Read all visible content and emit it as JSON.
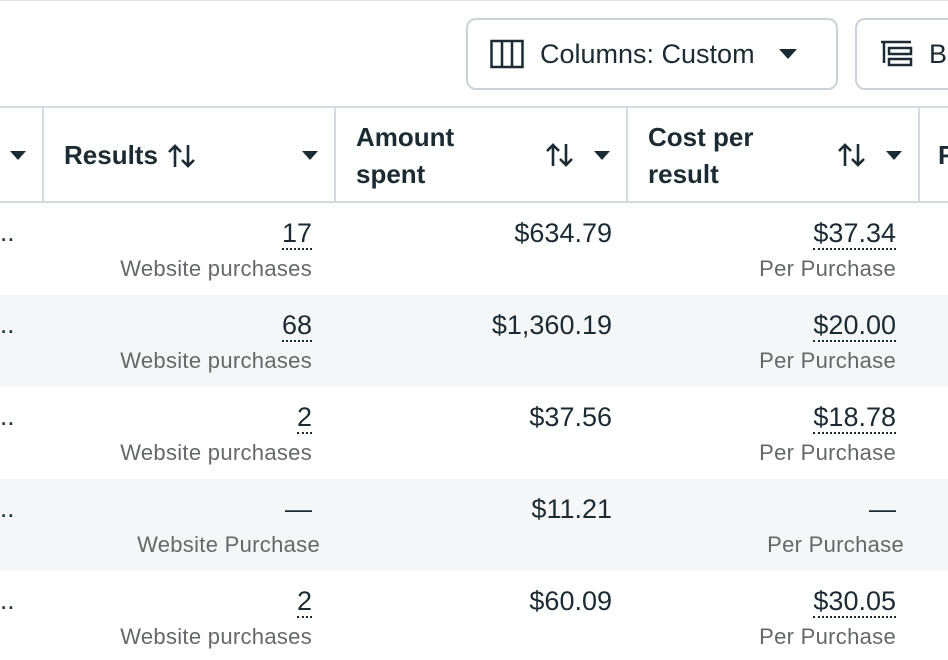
{
  "toolbar": {
    "columns_label": "Columns: Custom",
    "breakdown_label": "B"
  },
  "table": {
    "headers": {
      "results": "Results",
      "amount_line1": "Amount",
      "amount_line2": "spent",
      "cost_line1": "Cost per",
      "cost_line2": "result",
      "next_partial": "F"
    },
    "rows": [
      {
        "ellipsis": "..",
        "results": "17",
        "results_sub": "Website purchases",
        "amount": "$634.79",
        "cost": "$37.34",
        "cost_sub": "Per Purchase"
      },
      {
        "ellipsis": "..",
        "results": "68",
        "results_sub": "Website purchases",
        "amount": "$1,360.19",
        "cost": "$20.00",
        "cost_sub": "Per Purchase"
      },
      {
        "ellipsis": "..",
        "results": "2",
        "results_sub": "Website purchases",
        "amount": "$37.56",
        "cost": "$18.78",
        "cost_sub": "Per Purchase"
      },
      {
        "ellipsis": "..",
        "results": "—",
        "results_sub": "Website Purchase",
        "amount": "$11.21",
        "cost": "—",
        "cost_sub": "Per Purchase"
      },
      {
        "ellipsis": "..",
        "results": "2",
        "results_sub": "Website purchases",
        "amount": "$60.09",
        "cost": "$30.05",
        "cost_sub": "Per Purchase"
      }
    ]
  },
  "colors": {
    "text": "#1c2b33",
    "muted": "#65676b",
    "border": "#d5dae0",
    "row_alt": "#f5f6f7"
  },
  "icons": [
    "columns-icon",
    "breakdown-icon",
    "sort-icon",
    "dropdown-caret-icon"
  ]
}
